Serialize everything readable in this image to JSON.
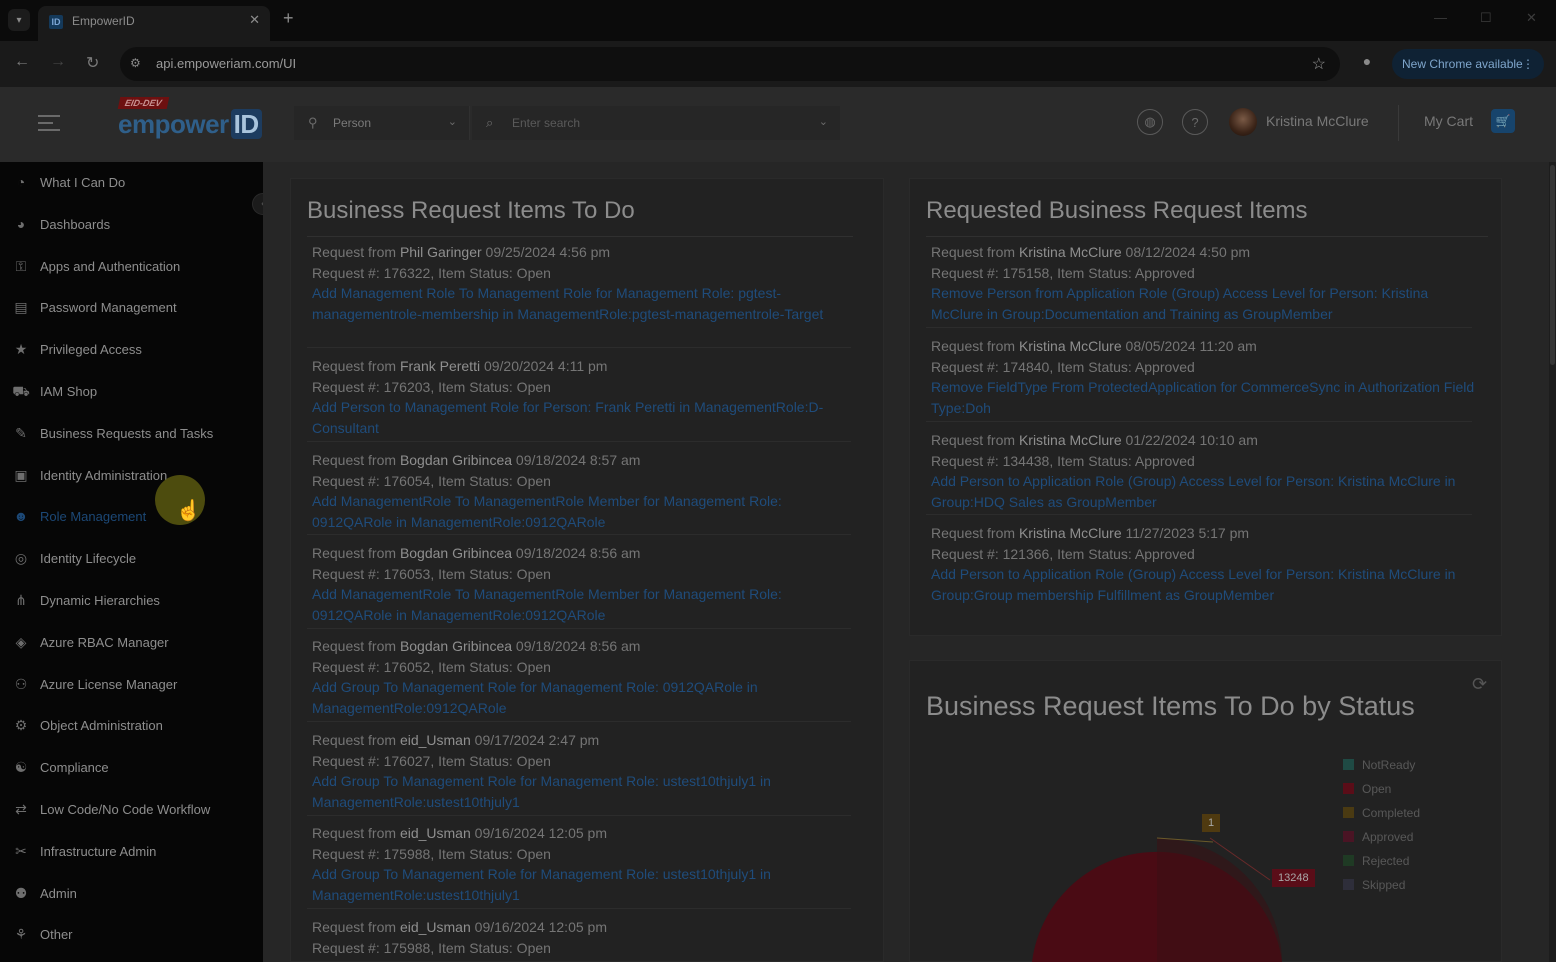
{
  "browser": {
    "tab_title": "EmpowerID",
    "url": "api.empoweriam.com/UI",
    "new_chrome": "New Chrome available"
  },
  "header": {
    "logo_badge": "EID-DEV",
    "logo_main": "empower",
    "logo_id": "ID",
    "search_type": "Person",
    "search_placeholder": "Enter search",
    "user_name": "Kristina McClure",
    "cart_label": "My Cart"
  },
  "sidebar": {
    "items": [
      {
        "label": "What I Can Do",
        "icon": "speedometer-icon"
      },
      {
        "label": "Dashboards",
        "icon": "dashboard-icon"
      },
      {
        "label": "Apps and Authentication",
        "icon": "user-key-icon"
      },
      {
        "label": "Password Management",
        "icon": "password-icon"
      },
      {
        "label": "Privileged Access",
        "icon": "star-shield-icon"
      },
      {
        "label": "IAM Shop",
        "icon": "cart-icon"
      },
      {
        "label": "Business Requests and Tasks",
        "icon": "edit-icon"
      },
      {
        "label": "Identity Administration",
        "icon": "id-card-icon"
      },
      {
        "label": "Role Management",
        "icon": "user-role-icon"
      },
      {
        "label": "Identity Lifecycle",
        "icon": "lifecycle-icon"
      },
      {
        "label": "Dynamic Hierarchies",
        "icon": "hierarchy-icon"
      },
      {
        "label": "Azure RBAC Manager",
        "icon": "cube-icon"
      },
      {
        "label": "Azure License Manager",
        "icon": "group-icon"
      },
      {
        "label": "Object Administration",
        "icon": "object-icon"
      },
      {
        "label": "Compliance",
        "icon": "compliance-icon"
      },
      {
        "label": "Low Code/No Code Workflow",
        "icon": "workflow-icon"
      },
      {
        "label": "Infrastructure Admin",
        "icon": "tools-icon"
      },
      {
        "label": "Admin",
        "icon": "admin-icon"
      },
      {
        "label": "Other",
        "icon": "other-icon"
      }
    ]
  },
  "todo": {
    "title": "Business Request Items To Do",
    "items": [
      {
        "prefix": "Request from ",
        "who": "Phil Garinger",
        "date": " 09/25/2024 4:56 pm",
        "meta": "Request #: 176322, Item Status: Open",
        "link": "Add Management Role To Management Role for Management Role: pgtest-managementrole-membership in ManagementRole:pgtest-managementrole-Target"
      },
      {
        "prefix": "Request from ",
        "who": "Frank Peretti",
        "date": " 09/20/2024 4:11 pm",
        "meta": "Request #: 176203, Item Status: Open",
        "link": "Add Person to Management Role for Person: Frank Peretti in ManagementRole:D-Consultant"
      },
      {
        "prefix": "Request from ",
        "who": "Bogdan Gribincea",
        "date": " 09/18/2024 8:57 am",
        "meta": "Request #: 176054, Item Status: Open",
        "link": "Add ManagementRole To ManagementRole Member for Management Role: 0912QARole in ManagementRole:0912QARole"
      },
      {
        "prefix": "Request from ",
        "who": "Bogdan Gribincea",
        "date": " 09/18/2024 8:56 am",
        "meta": "Request #: 176053, Item Status: Open",
        "link": "Add ManagementRole To ManagementRole Member for Management Role: 0912QARole in ManagementRole:0912QARole"
      },
      {
        "prefix": "Request from ",
        "who": "Bogdan Gribincea",
        "date": " 09/18/2024 8:56 am",
        "meta": "Request #: 176052, Item Status: Open",
        "link": "Add Group To Management Role for Management Role: 0912QARole in ManagementRole:0912QARole"
      },
      {
        "prefix": "Request from ",
        "who": "eid_Usman",
        "date": " 09/17/2024 2:47 pm",
        "meta": "Request #: 176027, Item Status: Open",
        "link": "Add Group To Management Role for Management Role: ustest10thjuly1 in ManagementRole:ustest10thjuly1"
      },
      {
        "prefix": "Request from ",
        "who": "eid_Usman",
        "date": " 09/16/2024 12:05 pm",
        "meta": "Request #: 175988, Item Status: Open",
        "link": "Add Group To Management Role for Management Role: ustest10thjuly1 in ManagementRole:ustest10thjuly1"
      },
      {
        "prefix": "Request from ",
        "who": "eid_Usman",
        "date": " 09/16/2024 12:05 pm",
        "meta": "Request #: 175988, Item Status: Open",
        "link": ""
      }
    ]
  },
  "requested": {
    "title": "Requested Business Request Items",
    "items": [
      {
        "prefix": "Request from ",
        "who": "Kristina McClure",
        "date": " 08/12/2024 4:50 pm",
        "meta": "Request #: 175158, Item Status: Approved",
        "link": "Remove Person from Application Role (Group) Access Level for Person: Kristina McClure in Group:Documentation and Training as GroupMember"
      },
      {
        "prefix": "Request from ",
        "who": "Kristina McClure",
        "date": " 08/05/2024 11:20 am",
        "meta": "Request #: 174840, Item Status: Approved",
        "link": "Remove FieldType From ProtectedApplication for CommerceSync in Authorization Field Type:Doh"
      },
      {
        "prefix": "Request from ",
        "who": "Kristina McClure",
        "date": " 01/22/2024 10:10 am",
        "meta": "Request #: 134438, Item Status: Approved",
        "link": "Add Person to Application Role (Group) Access Level for Person: Kristina McClure in Group:HDQ Sales as GroupMember"
      },
      {
        "prefix": "Request from ",
        "who": "Kristina McClure",
        "date": " 11/27/2023 5:17 pm",
        "meta": "Request #: 121366, Item Status: Approved",
        "link": "Add Person to Application Role (Group) Access Level for Person: Kristina McClure in Group:Group membership Fulfillment as GroupMember"
      }
    ]
  },
  "status_chart": {
    "title": "Business Request Items To Do by Status",
    "legend": [
      {
        "name": "NotReady",
        "color": "#1f4a44"
      },
      {
        "name": "Open",
        "color": "#5a0d18"
      },
      {
        "name": "Completed",
        "color": "#4a3a12"
      },
      {
        "name": "Approved",
        "color": "#4a1424"
      },
      {
        "name": "Rejected",
        "color": "#1f3a24"
      },
      {
        "name": "Skipped",
        "color": "#2e2e3a"
      }
    ],
    "labels": [
      {
        "text": "1",
        "color": "#4f3a10"
      },
      {
        "text": "13248",
        "color": "#5a0d18"
      }
    ]
  },
  "chart_data": {
    "type": "pie",
    "title": "Business Request Items To Do by Status",
    "categories": [
      "NotReady",
      "Open",
      "Completed",
      "Approved",
      "Rejected",
      "Skipped"
    ],
    "visible_data_labels": [
      {
        "category": "Completed",
        "value": 1
      },
      {
        "category": "Open",
        "value": 13248
      }
    ],
    "legend": "right"
  }
}
